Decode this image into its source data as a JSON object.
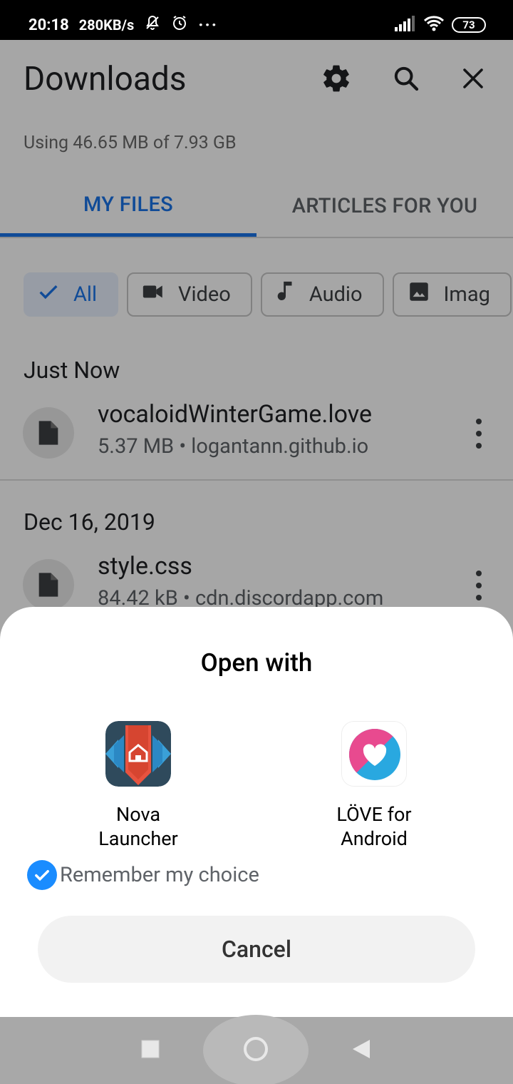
{
  "status_bar": {
    "time": "20:18",
    "speed": "280KB/s",
    "more": "···",
    "battery": "73"
  },
  "header": {
    "title": "Downloads",
    "storage": "Using 46.65 MB of 7.93 GB"
  },
  "tabs": [
    {
      "label": "MY FILES"
    },
    {
      "label": "ARTICLES FOR YOU"
    }
  ],
  "chips": [
    {
      "label": "All",
      "icon": "check-icon"
    },
    {
      "label": "Video",
      "icon": "video-icon"
    },
    {
      "label": "Audio",
      "icon": "music-icon"
    },
    {
      "label": "Imag",
      "icon": "image-icon"
    }
  ],
  "sections": [
    {
      "heading": "Just Now",
      "files": [
        {
          "name": "vocaloidWinterGame.love",
          "meta": "5.37 MB • logantann.github.io"
        }
      ]
    },
    {
      "heading": "Dec 16, 2019",
      "files": [
        {
          "name": "style.css",
          "meta": "84.42 kB • cdn.discordapp.com"
        }
      ]
    }
  ],
  "dialog": {
    "title": "Open with",
    "apps": [
      {
        "label": "Nova\nLauncher",
        "icon": "nova-launcher-icon"
      },
      {
        "label": "LÖVE for\nAndroid",
        "icon": "love-android-icon"
      }
    ],
    "remember": "Remember my choice",
    "remember_checked": true,
    "cancel": "Cancel"
  },
  "colors": {
    "accent": "#1a73e8",
    "checkbox": "#1a8cff",
    "nova_bg": "#2f4a5c",
    "nova_shield": "#e8533f",
    "love_pink": "#e84a8f",
    "love_blue": "#29a8e0"
  }
}
